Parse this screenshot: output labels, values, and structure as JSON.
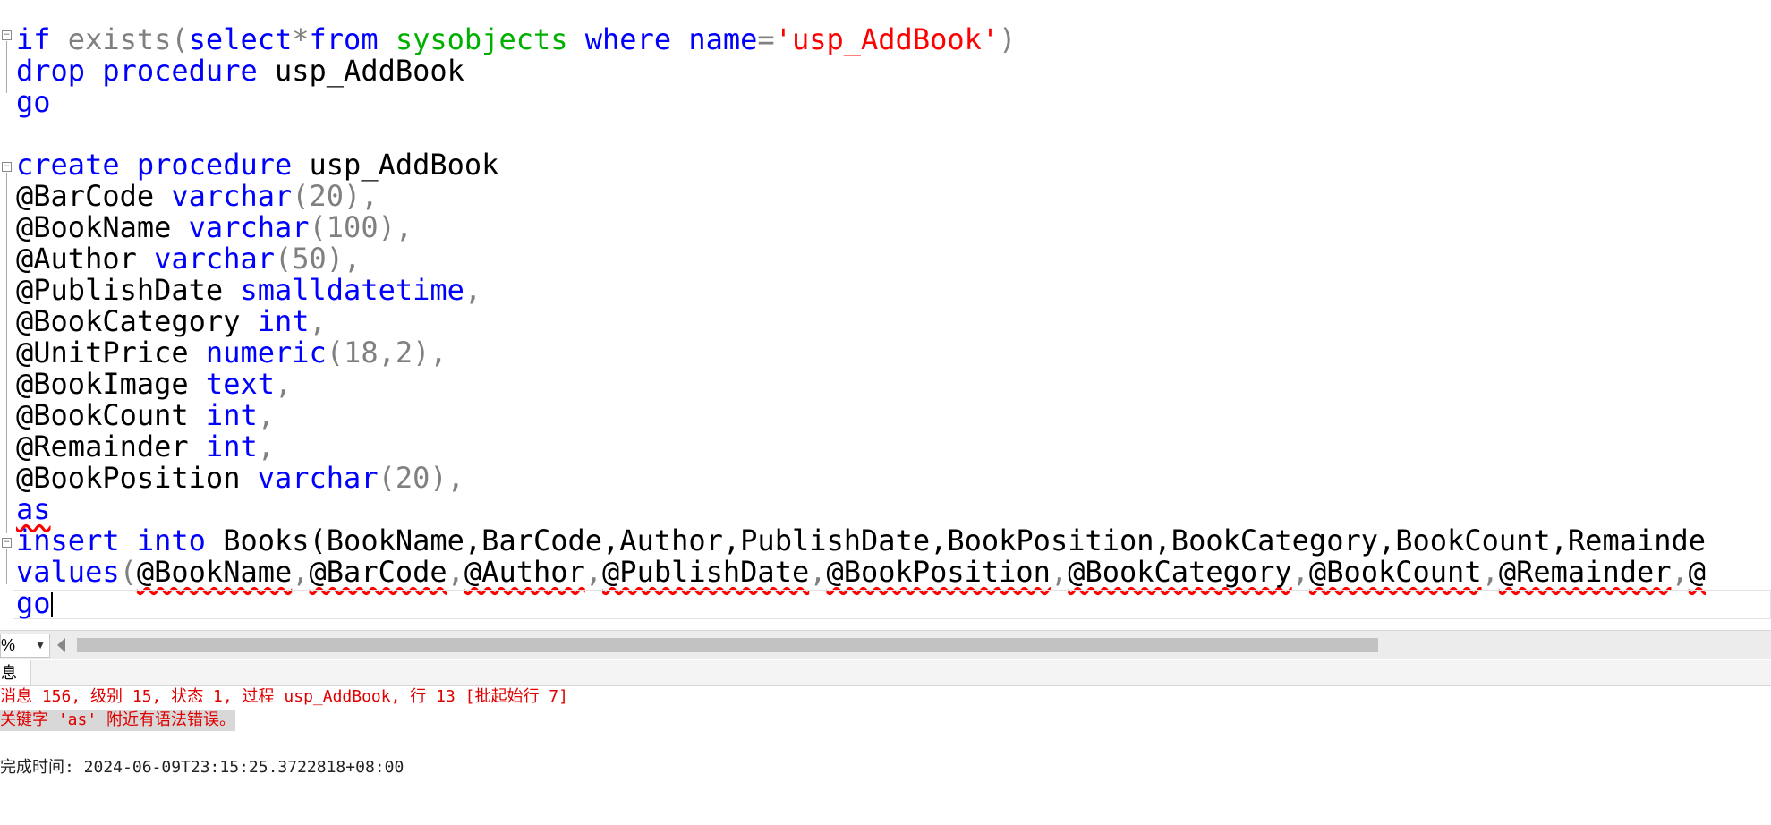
{
  "editor": {
    "lines": {
      "l1": [
        "if",
        " ",
        "exists",
        "(",
        "select",
        "*",
        "from",
        " ",
        "sysobjects",
        " ",
        "where",
        " ",
        "name",
        "=",
        "'usp_AddBook'",
        ")"
      ],
      "l2": [
        "drop",
        " ",
        "procedure",
        " usp_AddBook"
      ],
      "l3": [
        "go"
      ],
      "l5": [
        "create",
        " ",
        "procedure",
        " usp_AddBook"
      ],
      "params": [
        {
          "name": "@BarCode",
          "type": "varchar",
          "suffix": "(20),"
        },
        {
          "name": "@BookName",
          "type": "varchar",
          "suffix": "(100),"
        },
        {
          "name": "@Author",
          "type": "varchar",
          "suffix": "(50),"
        },
        {
          "name": "@PublishDate",
          "type": "smalldatetime",
          "suffix": ","
        },
        {
          "name": "@BookCategory",
          "type": "int",
          "suffix": ","
        },
        {
          "name": "@UnitPrice",
          "type": "numeric",
          "suffix": "(18,2),"
        },
        {
          "name": "@BookImage",
          "type": "text",
          "suffix": ","
        },
        {
          "name": "@BookCount",
          "type": "int",
          "suffix": ","
        },
        {
          "name": "@Remainder",
          "type": "int",
          "suffix": ","
        },
        {
          "name": "@BookPosition",
          "type": "varchar",
          "suffix": "(20),"
        }
      ],
      "as": "as",
      "insert": {
        "kw1": "insert",
        "kw2": "into",
        "table": " Books",
        "cols": "(BookName,BarCode,Author,PublishDate,BookPosition,BookCategory,BookCount,Remainde"
      },
      "values": {
        "kw": "values",
        "open": "(",
        "args": [
          "@BookName",
          "@BarCode",
          "@Author",
          "@PublishDate",
          "@BookPosition",
          "@BookCategory",
          "@BookCount",
          "@Remainder",
          "@"
        ]
      },
      "go_end": "go"
    }
  },
  "statusbar": {
    "zoom_value": "%"
  },
  "results": {
    "tab_label": "息",
    "message_line1": "消息 156, 级别 15, 状态 1, 过程 usp_AddBook, 行 13 [批起始行 7]",
    "message_line2": "关键字 'as' 附近有语法错误。",
    "completion": "完成时间: 2024-06-09T23:15:25.3722818+08:00"
  },
  "colors": {
    "keyword": "#0000ff",
    "string": "#ff0000",
    "system_object": "#00b000",
    "operator": "#808080",
    "error_text": "#e00000"
  }
}
